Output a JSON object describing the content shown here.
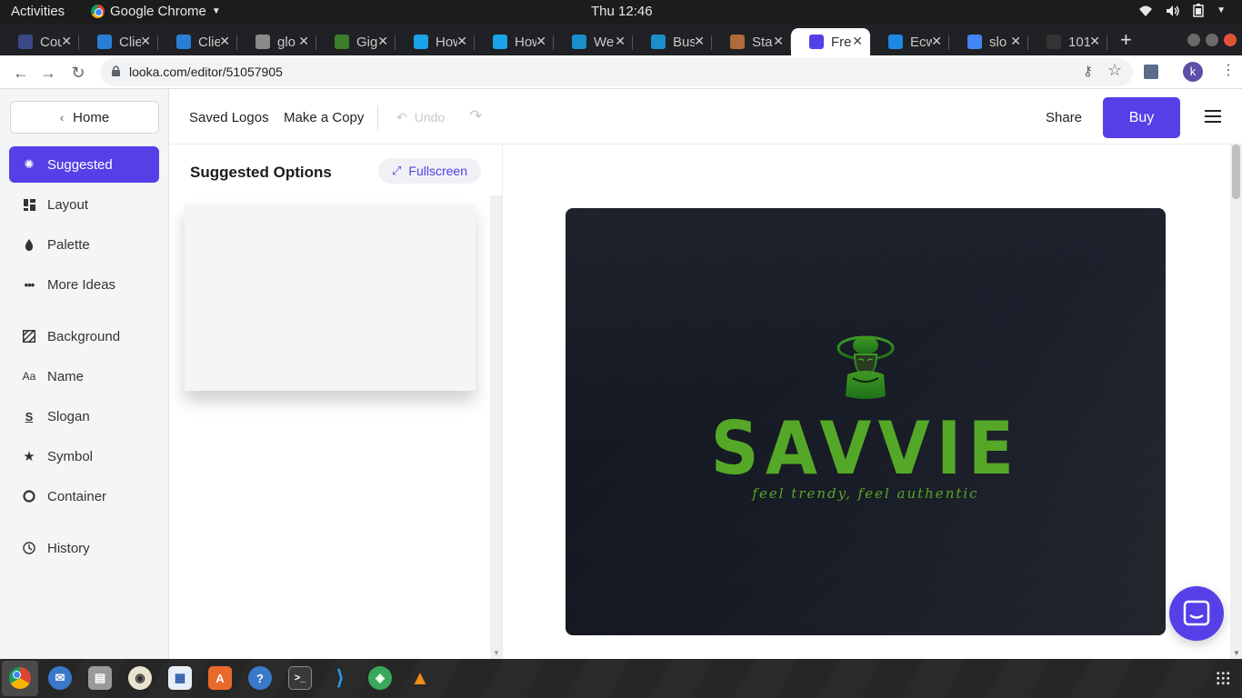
{
  "topbar": {
    "activities": "Activities",
    "app_name": "Google Chrome",
    "clock": "Thu 12:46"
  },
  "tabs": [
    {
      "title": "Cou",
      "favicon_color": "#3b4a86"
    },
    {
      "title": "Clie",
      "favicon_color": "#2a7fd4"
    },
    {
      "title": "Clie",
      "favicon_color": "#2a7fd4"
    },
    {
      "title": "glo",
      "favicon_color": "#8a8a8a"
    },
    {
      "title": "Gig",
      "favicon_color": "#3a7d2a"
    },
    {
      "title": "How",
      "favicon_color": "#1aa3e8"
    },
    {
      "title": "How",
      "favicon_color": "#1aa3e8"
    },
    {
      "title": "We",
      "favicon_color": "#1a8fc9"
    },
    {
      "title": "Bus",
      "favicon_color": "#1a8fc9"
    },
    {
      "title": "Sta",
      "favicon_color": "#b06b3a"
    },
    {
      "title": "Fre",
      "favicon_color": "#5540e8",
      "active": true
    },
    {
      "title": "Ecw",
      "favicon_color": "#1e88e5"
    },
    {
      "title": "slo",
      "favicon_color": "#4285f4"
    },
    {
      "title": "101",
      "favicon_color": "#333333"
    }
  ],
  "addressbar": {
    "url": "looka.com/editor/51057905",
    "profile_initial": "k"
  },
  "sidebar": {
    "home": "Home",
    "items": [
      {
        "label": "Suggested",
        "icon": "bulb-icon",
        "active": true
      },
      {
        "label": "Layout",
        "icon": "layout-icon"
      },
      {
        "label": "Palette",
        "icon": "drop-icon"
      },
      {
        "label": "More Ideas",
        "icon": "dots-icon"
      },
      {
        "label": "Background",
        "icon": "hatch-icon"
      },
      {
        "label": "Name",
        "icon": "text-icon"
      },
      {
        "label": "Slogan",
        "icon": "slogan-icon"
      },
      {
        "label": "Symbol",
        "icon": "star-icon"
      },
      {
        "label": "Container",
        "icon": "circle-icon"
      },
      {
        "label": "History",
        "icon": "clock-icon"
      }
    ]
  },
  "toolbar": {
    "saved_logos": "Saved Logos",
    "make_copy": "Make a Copy",
    "undo": "Undo",
    "share": "Share",
    "buy": "Buy"
  },
  "options": {
    "title": "Suggested Options",
    "fullscreen": "Fullscreen"
  },
  "logo": {
    "name": "SAVVIE",
    "slogan": "feel trendy, feel authentic",
    "color": "#55a827"
  },
  "colors": {
    "accent": "#5540e8"
  }
}
